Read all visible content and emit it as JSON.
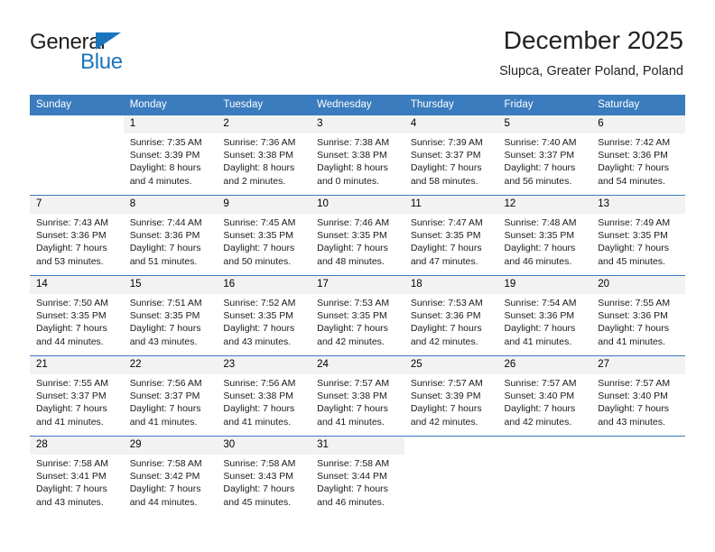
{
  "brand": {
    "name_top": "General",
    "name_bottom": "Blue",
    "accent_color": "#1b75bc",
    "triangle_icon": "triangle-icon"
  },
  "header": {
    "title": "December 2025",
    "subtitle": "Slupca, Greater Poland, Poland"
  },
  "calendar": {
    "header_bg": "#3a7cbe",
    "daynum_bg": "#f2f2f2",
    "weekdays": [
      "Sunday",
      "Monday",
      "Tuesday",
      "Wednesday",
      "Thursday",
      "Friday",
      "Saturday"
    ],
    "weeks": [
      [
        {
          "day": "",
          "lines": []
        },
        {
          "day": "1",
          "lines": [
            "Sunrise: 7:35 AM",
            "Sunset: 3:39 PM",
            "Daylight: 8 hours",
            "and 4 minutes."
          ]
        },
        {
          "day": "2",
          "lines": [
            "Sunrise: 7:36 AM",
            "Sunset: 3:38 PM",
            "Daylight: 8 hours",
            "and 2 minutes."
          ]
        },
        {
          "day": "3",
          "lines": [
            "Sunrise: 7:38 AM",
            "Sunset: 3:38 PM",
            "Daylight: 8 hours",
            "and 0 minutes."
          ]
        },
        {
          "day": "4",
          "lines": [
            "Sunrise: 7:39 AM",
            "Sunset: 3:37 PM",
            "Daylight: 7 hours",
            "and 58 minutes."
          ]
        },
        {
          "day": "5",
          "lines": [
            "Sunrise: 7:40 AM",
            "Sunset: 3:37 PM",
            "Daylight: 7 hours",
            "and 56 minutes."
          ]
        },
        {
          "day": "6",
          "lines": [
            "Sunrise: 7:42 AM",
            "Sunset: 3:36 PM",
            "Daylight: 7 hours",
            "and 54 minutes."
          ]
        }
      ],
      [
        {
          "day": "7",
          "lines": [
            "Sunrise: 7:43 AM",
            "Sunset: 3:36 PM",
            "Daylight: 7 hours",
            "and 53 minutes."
          ]
        },
        {
          "day": "8",
          "lines": [
            "Sunrise: 7:44 AM",
            "Sunset: 3:36 PM",
            "Daylight: 7 hours",
            "and 51 minutes."
          ]
        },
        {
          "day": "9",
          "lines": [
            "Sunrise: 7:45 AM",
            "Sunset: 3:35 PM",
            "Daylight: 7 hours",
            "and 50 minutes."
          ]
        },
        {
          "day": "10",
          "lines": [
            "Sunrise: 7:46 AM",
            "Sunset: 3:35 PM",
            "Daylight: 7 hours",
            "and 48 minutes."
          ]
        },
        {
          "day": "11",
          "lines": [
            "Sunrise: 7:47 AM",
            "Sunset: 3:35 PM",
            "Daylight: 7 hours",
            "and 47 minutes."
          ]
        },
        {
          "day": "12",
          "lines": [
            "Sunrise: 7:48 AM",
            "Sunset: 3:35 PM",
            "Daylight: 7 hours",
            "and 46 minutes."
          ]
        },
        {
          "day": "13",
          "lines": [
            "Sunrise: 7:49 AM",
            "Sunset: 3:35 PM",
            "Daylight: 7 hours",
            "and 45 minutes."
          ]
        }
      ],
      [
        {
          "day": "14",
          "lines": [
            "Sunrise: 7:50 AM",
            "Sunset: 3:35 PM",
            "Daylight: 7 hours",
            "and 44 minutes."
          ]
        },
        {
          "day": "15",
          "lines": [
            "Sunrise: 7:51 AM",
            "Sunset: 3:35 PM",
            "Daylight: 7 hours",
            "and 43 minutes."
          ]
        },
        {
          "day": "16",
          "lines": [
            "Sunrise: 7:52 AM",
            "Sunset: 3:35 PM",
            "Daylight: 7 hours",
            "and 43 minutes."
          ]
        },
        {
          "day": "17",
          "lines": [
            "Sunrise: 7:53 AM",
            "Sunset: 3:35 PM",
            "Daylight: 7 hours",
            "and 42 minutes."
          ]
        },
        {
          "day": "18",
          "lines": [
            "Sunrise: 7:53 AM",
            "Sunset: 3:36 PM",
            "Daylight: 7 hours",
            "and 42 minutes."
          ]
        },
        {
          "day": "19",
          "lines": [
            "Sunrise: 7:54 AM",
            "Sunset: 3:36 PM",
            "Daylight: 7 hours",
            "and 41 minutes."
          ]
        },
        {
          "day": "20",
          "lines": [
            "Sunrise: 7:55 AM",
            "Sunset: 3:36 PM",
            "Daylight: 7 hours",
            "and 41 minutes."
          ]
        }
      ],
      [
        {
          "day": "21",
          "lines": [
            "Sunrise: 7:55 AM",
            "Sunset: 3:37 PM",
            "Daylight: 7 hours",
            "and 41 minutes."
          ]
        },
        {
          "day": "22",
          "lines": [
            "Sunrise: 7:56 AM",
            "Sunset: 3:37 PM",
            "Daylight: 7 hours",
            "and 41 minutes."
          ]
        },
        {
          "day": "23",
          "lines": [
            "Sunrise: 7:56 AM",
            "Sunset: 3:38 PM",
            "Daylight: 7 hours",
            "and 41 minutes."
          ]
        },
        {
          "day": "24",
          "lines": [
            "Sunrise: 7:57 AM",
            "Sunset: 3:38 PM",
            "Daylight: 7 hours",
            "and 41 minutes."
          ]
        },
        {
          "day": "25",
          "lines": [
            "Sunrise: 7:57 AM",
            "Sunset: 3:39 PM",
            "Daylight: 7 hours",
            "and 42 minutes."
          ]
        },
        {
          "day": "26",
          "lines": [
            "Sunrise: 7:57 AM",
            "Sunset: 3:40 PM",
            "Daylight: 7 hours",
            "and 42 minutes."
          ]
        },
        {
          "day": "27",
          "lines": [
            "Sunrise: 7:57 AM",
            "Sunset: 3:40 PM",
            "Daylight: 7 hours",
            "and 43 minutes."
          ]
        }
      ],
      [
        {
          "day": "28",
          "lines": [
            "Sunrise: 7:58 AM",
            "Sunset: 3:41 PM",
            "Daylight: 7 hours",
            "and 43 minutes."
          ]
        },
        {
          "day": "29",
          "lines": [
            "Sunrise: 7:58 AM",
            "Sunset: 3:42 PM",
            "Daylight: 7 hours",
            "and 44 minutes."
          ]
        },
        {
          "day": "30",
          "lines": [
            "Sunrise: 7:58 AM",
            "Sunset: 3:43 PM",
            "Daylight: 7 hours",
            "and 45 minutes."
          ]
        },
        {
          "day": "31",
          "lines": [
            "Sunrise: 7:58 AM",
            "Sunset: 3:44 PM",
            "Daylight: 7 hours",
            "and 46 minutes."
          ]
        },
        {
          "day": "",
          "lines": []
        },
        {
          "day": "",
          "lines": []
        },
        {
          "day": "",
          "lines": []
        }
      ]
    ]
  }
}
